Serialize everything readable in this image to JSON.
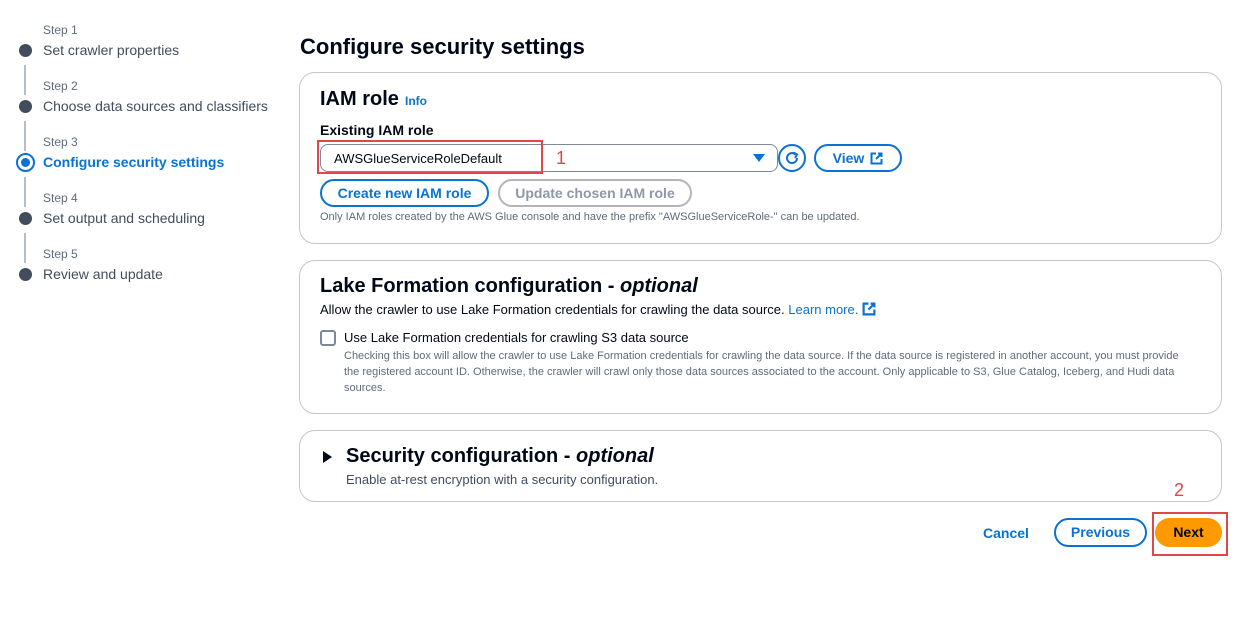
{
  "steps": [
    {
      "num": "Step 1",
      "title": "Set crawler properties"
    },
    {
      "num": "Step 2",
      "title": "Choose data sources and classifiers"
    },
    {
      "num": "Step 3",
      "title": "Configure security settings"
    },
    {
      "num": "Step 4",
      "title": "Set output and scheduling"
    },
    {
      "num": "Step 5",
      "title": "Review and update"
    }
  ],
  "active_step": 3,
  "page_title": "Configure security settings",
  "iam": {
    "heading": "IAM role",
    "info": "Info",
    "field_label": "Existing IAM role",
    "selected_role": "AWSGlueServiceRoleDefault",
    "view_label": "View",
    "create_label": "Create new IAM role",
    "update_label": "Update chosen IAM role",
    "help_text": "Only IAM roles created by the AWS Glue console and have the prefix \"AWSGlueServiceRole-\" can be updated."
  },
  "lake": {
    "heading": "Lake Formation configuration - ",
    "optional": "optional",
    "description": "Allow the crawler to use Lake Formation credentials for crawling the data source.",
    "learn_more": "Learn more.",
    "checkbox_label": "Use Lake Formation credentials for crawling S3 data source",
    "checkbox_checked": false,
    "checkbox_description": "Checking this box will allow the crawler to use Lake Formation credentials for crawling the data source. If the data source is registered in another account, you must provide the registered account ID. Otherwise, the crawler will crawl only those data sources associated to the account. Only applicable to S3, Glue Catalog, Iceberg, and Hudi data sources."
  },
  "security": {
    "heading": "Security configuration - ",
    "optional": "optional",
    "description": "Enable at-rest encryption with a security configuration."
  },
  "footer": {
    "cancel": "Cancel",
    "previous": "Previous",
    "next": "Next"
  },
  "annotations": {
    "one": "1",
    "two": "2"
  },
  "colors": {
    "accent": "#0972d3",
    "primary_button": "#ff9900",
    "annotation": "#e0474b"
  }
}
